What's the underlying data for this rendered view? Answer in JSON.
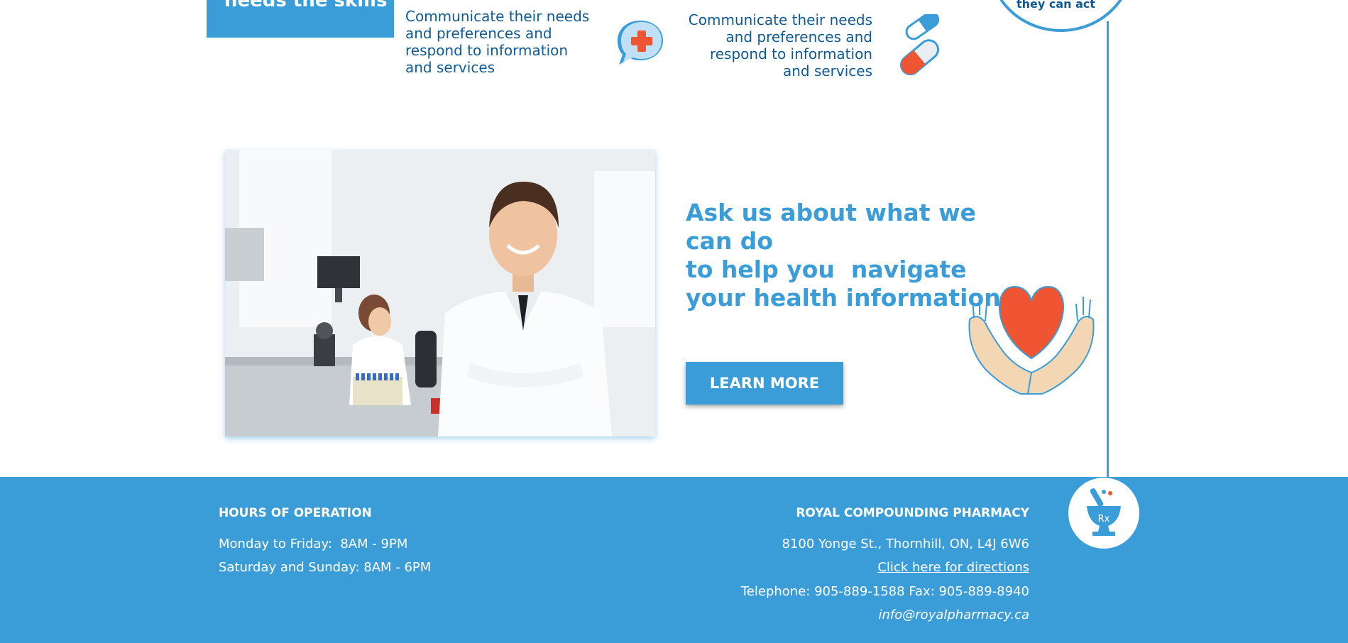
{
  "top": {
    "box_text": "needs the skills to:",
    "left_item": "Communicate their needs and preferences and respond to information and services",
    "right_item": "Communicate their needs and preferences and respond to information and services",
    "circle_text": "they can act"
  },
  "middle": {
    "headline_line1": "Ask us about what we can do",
    "headline_line2": "to help you  navigate",
    "headline_line3": "your health information.",
    "button_label": "LEARN MORE"
  },
  "footer": {
    "hours_title": "HOURS OF OPERATION",
    "hours_weekday": "Monday to Friday:  8AM - 9PM",
    "hours_weekend": "Saturday and Sunday: 8AM - 6PM",
    "pharmacy_name": "ROYAL COMPOUNDING PHARMACY",
    "address": "8100 Yonge St., Thornhill, ON, L4J 6W6",
    "directions_link": "Click here for directions",
    "phone": "Telephone: 905-889-1588 Fax: 905-889-8940",
    "email": "info@royalpharmacy.ca",
    "rx_label": "Rx"
  },
  "colors": {
    "brand_blue": "#3b9dd8",
    "dark_blue": "#0f5a93",
    "accent_red": "#f05533",
    "skin": "#f3d6b3"
  },
  "icons": [
    "medical-cross-chat-icon",
    "capsule-pills-icon",
    "heart-in-hands-icon",
    "mortar-pestle-rx-icon"
  ]
}
